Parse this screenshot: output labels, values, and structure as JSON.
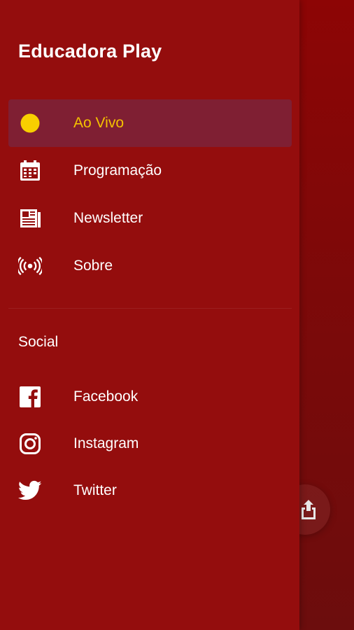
{
  "app": {
    "title": "Educadora Play"
  },
  "menu": {
    "items": [
      {
        "label": "Ao Vivo",
        "icon": "live-dot-icon",
        "active": true
      },
      {
        "label": "Programação",
        "icon": "calendar-icon"
      },
      {
        "label": "Newsletter",
        "icon": "newspaper-icon"
      },
      {
        "label": "Sobre",
        "icon": "broadcast-icon"
      }
    ]
  },
  "social": {
    "heading": "Social",
    "items": [
      {
        "label": "Facebook",
        "icon": "facebook-icon"
      },
      {
        "label": "Instagram",
        "icon": "instagram-icon"
      },
      {
        "label": "Twitter",
        "icon": "twitter-icon"
      }
    ]
  },
  "colors": {
    "drawer_bg": "#940d0d",
    "active_bg": "#7f1f33",
    "active_text": "#f5c200",
    "text": "#ffffff"
  }
}
